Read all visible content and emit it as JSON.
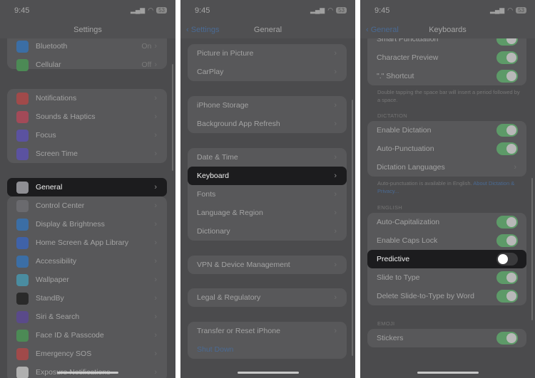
{
  "status": {
    "time": "9:45",
    "battery": "53"
  },
  "panels": [
    {
      "title": "Settings",
      "back": "",
      "rows": [
        {
          "label": "Bluetooth",
          "value": "On",
          "icon": "bluetooth-icon",
          "color": "#3b6ea5"
        },
        {
          "label": "Cellular",
          "value": "Off",
          "icon": "cellular-icon",
          "color": "#4c8a55"
        },
        {
          "label": "Notifications",
          "icon": "notifications-icon",
          "color": "#a04a4a"
        },
        {
          "label": "Sounds & Haptics",
          "icon": "sounds-icon",
          "color": "#a24a58"
        },
        {
          "label": "Focus",
          "icon": "focus-moon-icon",
          "color": "#5b52a0"
        },
        {
          "label": "Screen Time",
          "icon": "hourglass-icon",
          "color": "#5b52a0"
        },
        {
          "label": "General",
          "icon": "gear-icon",
          "color": "#8e8e93",
          "highlighted": true
        },
        {
          "label": "Control Center",
          "icon": "control-center-icon",
          "color": "#6a6a6e"
        },
        {
          "label": "Display & Brightness",
          "icon": "display-icon",
          "color": "#3b6ea5"
        },
        {
          "label": "Home Screen & App Library",
          "icon": "home-screen-icon",
          "color": "#3f62a8"
        },
        {
          "label": "Accessibility",
          "icon": "accessibility-icon",
          "color": "#3b6ea5"
        },
        {
          "label": "Wallpaper",
          "icon": "wallpaper-icon",
          "color": "#4a8ca0"
        },
        {
          "label": "StandBy",
          "icon": "standby-icon",
          "color": "#2a2a2a"
        },
        {
          "label": "Siri & Search",
          "icon": "siri-icon",
          "color": "#5a4a8a"
        },
        {
          "label": "Face ID & Passcode",
          "icon": "face-id-icon",
          "color": "#4c8a55"
        },
        {
          "label": "Emergency SOS",
          "icon": "sos-icon",
          "color": "#a04a4a"
        },
        {
          "label": "Exposure Notifications",
          "icon": "exposure-icon",
          "color": "#b0b0b0"
        }
      ]
    },
    {
      "title": "General",
      "back": "Settings",
      "rows": [
        {
          "label": "Picture in Picture"
        },
        {
          "label": "CarPlay"
        },
        {
          "label": "iPhone Storage"
        },
        {
          "label": "Background App Refresh"
        },
        {
          "label": "Date & Time"
        },
        {
          "label": "Keyboard",
          "highlighted": true
        },
        {
          "label": "Fonts"
        },
        {
          "label": "Language & Region"
        },
        {
          "label": "Dictionary"
        },
        {
          "label": "VPN & Device Management"
        },
        {
          "label": "Legal & Regulatory"
        },
        {
          "label": "Transfer or Reset iPhone"
        },
        {
          "label": "Shut Down",
          "link": true
        }
      ]
    },
    {
      "title": "Keyboards",
      "back": "General",
      "rows": [
        {
          "label": "Smart Punctuation",
          "on": true
        },
        {
          "label": "Character Preview",
          "on": true
        },
        {
          "label": "\".\" Shortcut",
          "on": true
        },
        {
          "label": "Enable Dictation",
          "on": true
        },
        {
          "label": "Auto-Punctuation",
          "on": true
        },
        {
          "label": "Dictation Languages",
          "chevron": true
        },
        {
          "label": "Auto-Capitalization",
          "on": true
        },
        {
          "label": "Enable Caps Lock",
          "on": true
        },
        {
          "label": "Predictive",
          "on": false,
          "highlighted": true
        },
        {
          "label": "Slide to Type",
          "on": true
        },
        {
          "label": "Delete Slide-to-Type by Word",
          "on": true
        },
        {
          "label": "Stickers",
          "on": true
        }
      ],
      "notes": {
        "period": "Double tapping the space bar will insert a period followed by a space.",
        "dictation_section": "DICTATION",
        "autopunct": "Auto-punctuation is available in English.",
        "autopunct_link": "About Dictation & Privacy...",
        "english_section": "ENGLISH",
        "emoji_section": "EMOJI"
      }
    }
  ]
}
